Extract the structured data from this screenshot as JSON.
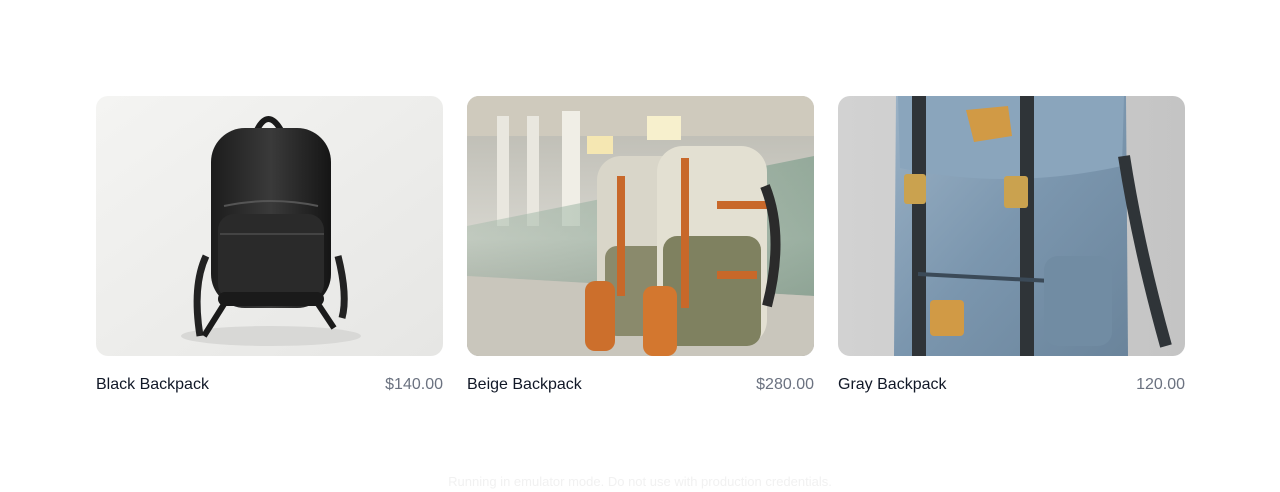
{
  "products": [
    {
      "name": "Black Backpack",
      "price": "$140.00",
      "image": "black-backpack-photo"
    },
    {
      "name": "Beige Backpack",
      "price": "$280.00",
      "image": "beige-backpack-photo"
    },
    {
      "name": "Gray Backpack",
      "price": "120.00",
      "image": "gray-backpack-photo"
    }
  ],
  "footer": {
    "notice": "Running in emulator mode. Do not use with production credentials."
  },
  "colors": {
    "name_text": "#111827",
    "price_text": "#6b7280",
    "notice_text": "#f1f1f1"
  }
}
